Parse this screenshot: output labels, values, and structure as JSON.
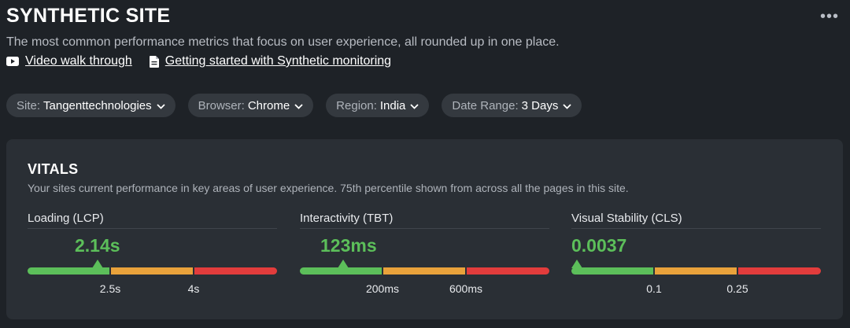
{
  "header": {
    "title": "SYNTHETIC SITE",
    "subtitle": "The most common performance metrics that focus on user experience, all rounded up in one place.",
    "more_icon": "more-icon",
    "links": [
      {
        "label": "Video walk through",
        "icon": "video-icon"
      },
      {
        "label": "Getting started with Synthetic monitoring",
        "icon": "document-icon"
      }
    ]
  },
  "filters": [
    {
      "label": "Site:",
      "value": "Tangenttechnologies"
    },
    {
      "label": "Browser:",
      "value": "Chrome"
    },
    {
      "label": "Region:",
      "value": "India"
    },
    {
      "label": "Date Range:",
      "value": "3 Days"
    }
  ],
  "vitals": {
    "title": "VITALS",
    "subtitle": "Your sites current performance in key areas of user experience. 75th percentile shown from across all the pages in this site.",
    "metrics": [
      {
        "label": "Loading (LCP)",
        "value": "2.14s",
        "thresholds": [
          "2.5s",
          "4s"
        ]
      },
      {
        "label": "Interactivity (TBT)",
        "value": "123ms",
        "thresholds": [
          "200ms",
          "600ms"
        ]
      },
      {
        "label": "Visual Stability (CLS)",
        "value": "0.0037",
        "thresholds": [
          "0.1",
          "0.25"
        ]
      }
    ]
  },
  "colors": {
    "good": "#5cbf5a",
    "needs_improvement": "#e9a23b",
    "poor": "#e23c3c",
    "background": "#1e2227",
    "card": "#2a2f35",
    "pill": "#34393f"
  }
}
